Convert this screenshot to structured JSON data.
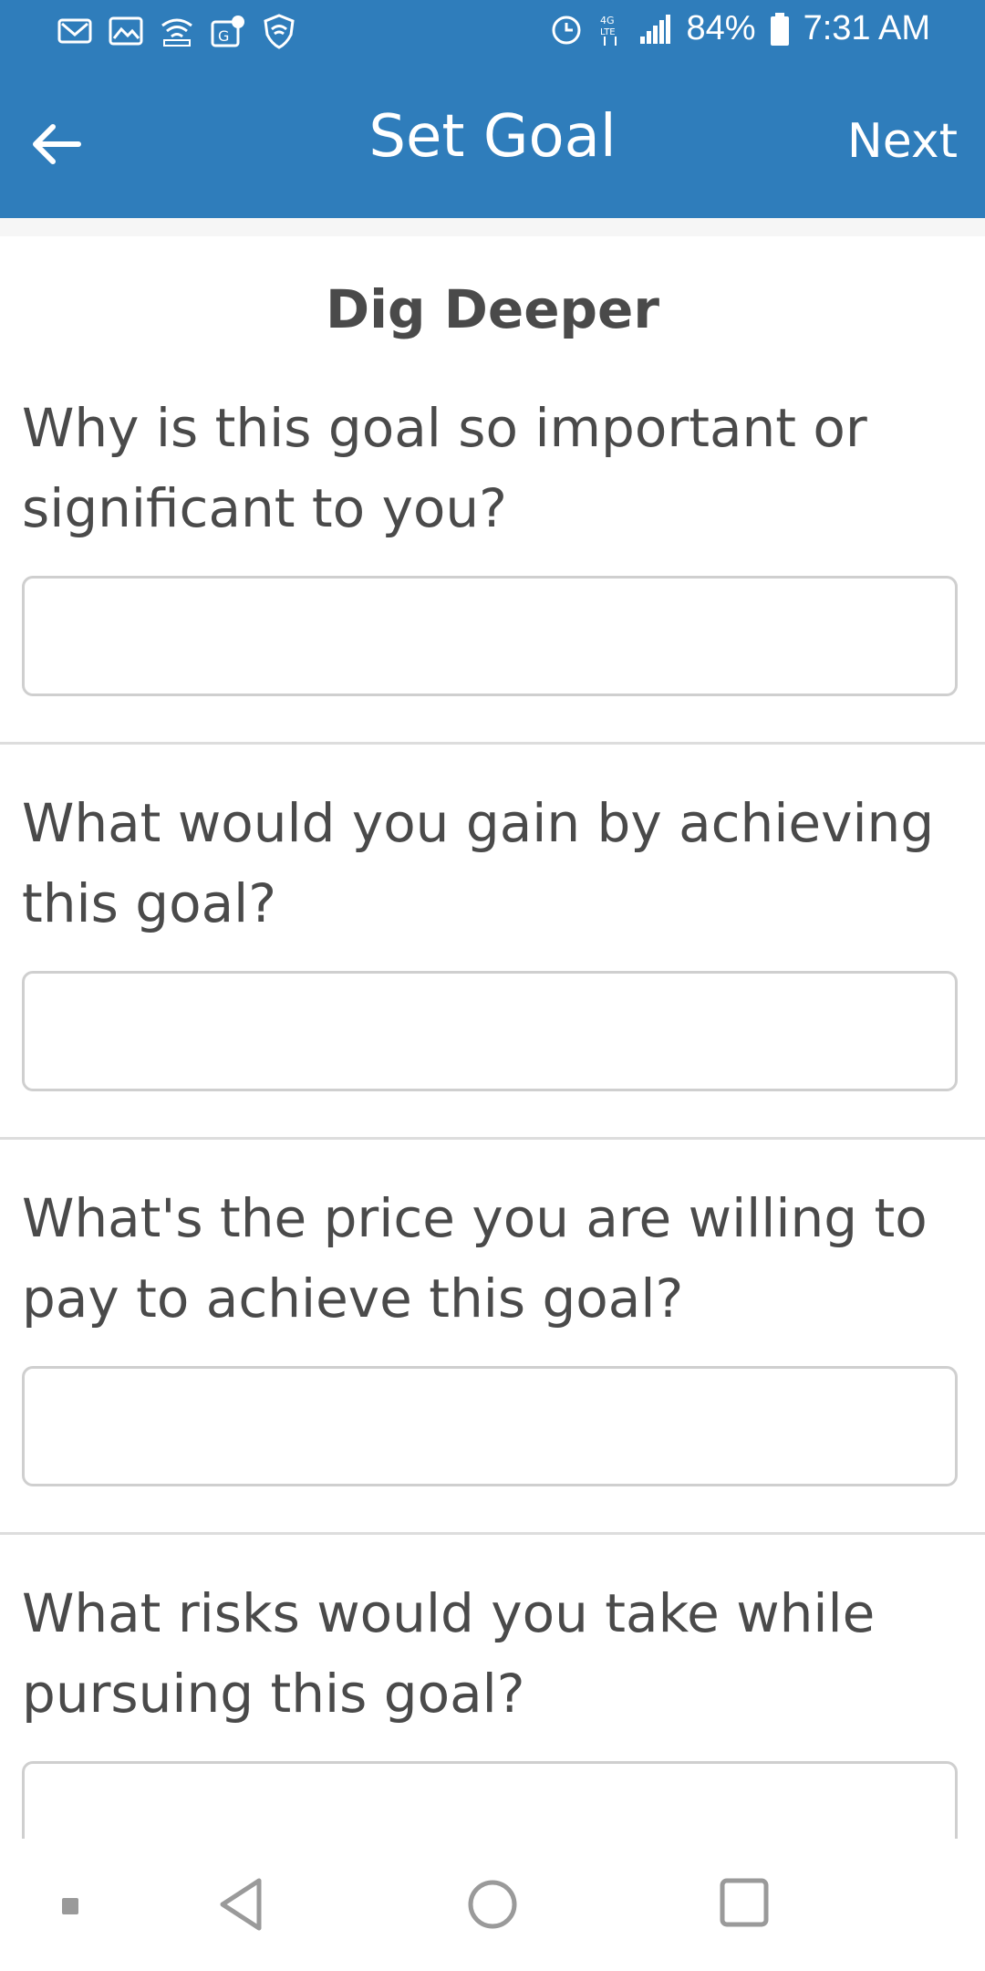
{
  "status_bar": {
    "battery_percent": "84%",
    "time": "7:31 AM",
    "icons": [
      "gmail-icon",
      "gallery-icon",
      "wifi-hotspot-icon",
      "google-maps-icon",
      "vpn-shield-icon",
      "alarm-icon",
      "4g-lte-icon",
      "signal-icon",
      "battery-icon"
    ]
  },
  "app_bar": {
    "title": "Set Goal",
    "next_label": "Next",
    "back_icon": "back-arrow-icon",
    "color": "#2f7dbb"
  },
  "main": {
    "section_title": "Dig Deeper",
    "questions": [
      {
        "label": "Why is this goal so important or significant to you?",
        "value": ""
      },
      {
        "label": "What would you gain by achieving this goal?",
        "value": ""
      },
      {
        "label": "What's the price you are willing to pay to achieve this goal?",
        "value": ""
      },
      {
        "label": "What risks would you take while pursuing this goal?",
        "value": ""
      }
    ]
  },
  "nav_bar": {
    "icons": [
      "recent-apps-dot-icon",
      "back-triangle-icon",
      "home-circle-icon",
      "overview-square-icon"
    ]
  }
}
